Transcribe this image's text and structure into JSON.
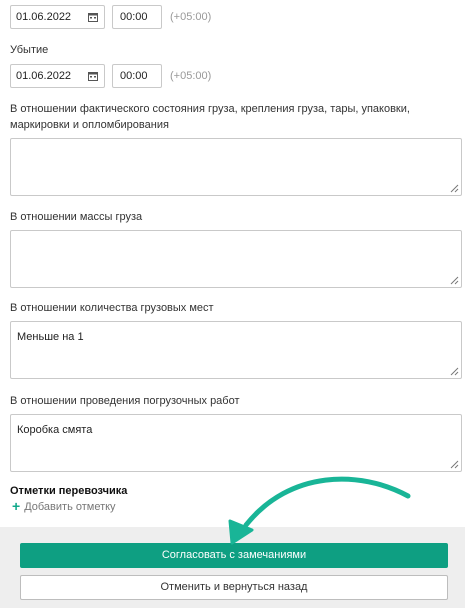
{
  "arrival": {
    "date": "01.06.2022",
    "time": "00:00",
    "tz": "(+05:00)"
  },
  "departure": {
    "label": "Убытие",
    "date": "01.06.2022",
    "time": "00:00",
    "tz": "(+05:00)"
  },
  "fields": [
    {
      "label_line1": "В отношении фактического состояния груза, крепления груза, тары, упаковки,",
      "label_line2": "маркировки и опломбирования",
      "value": ""
    },
    {
      "label": "В отношении массы груза",
      "value": ""
    },
    {
      "label": "В отношении количества грузовых мест",
      "value": "Меньше на 1"
    },
    {
      "label": "В отношении проведения погрузочных работ",
      "value": "Коробка смята"
    }
  ],
  "carrier_notes": {
    "title": "Отметки перевозчика",
    "add_label": "Добавить отметку"
  },
  "footer": {
    "approve_label": "Согласовать с замечаниями",
    "cancel_label": "Отменить и вернуться назад"
  },
  "colors": {
    "accent": "#0e9f82",
    "arrow": "#19b597"
  },
  "icons": [
    "calendar-icon",
    "resize-handle-icon",
    "plus-icon",
    "annotation-arrow"
  ]
}
